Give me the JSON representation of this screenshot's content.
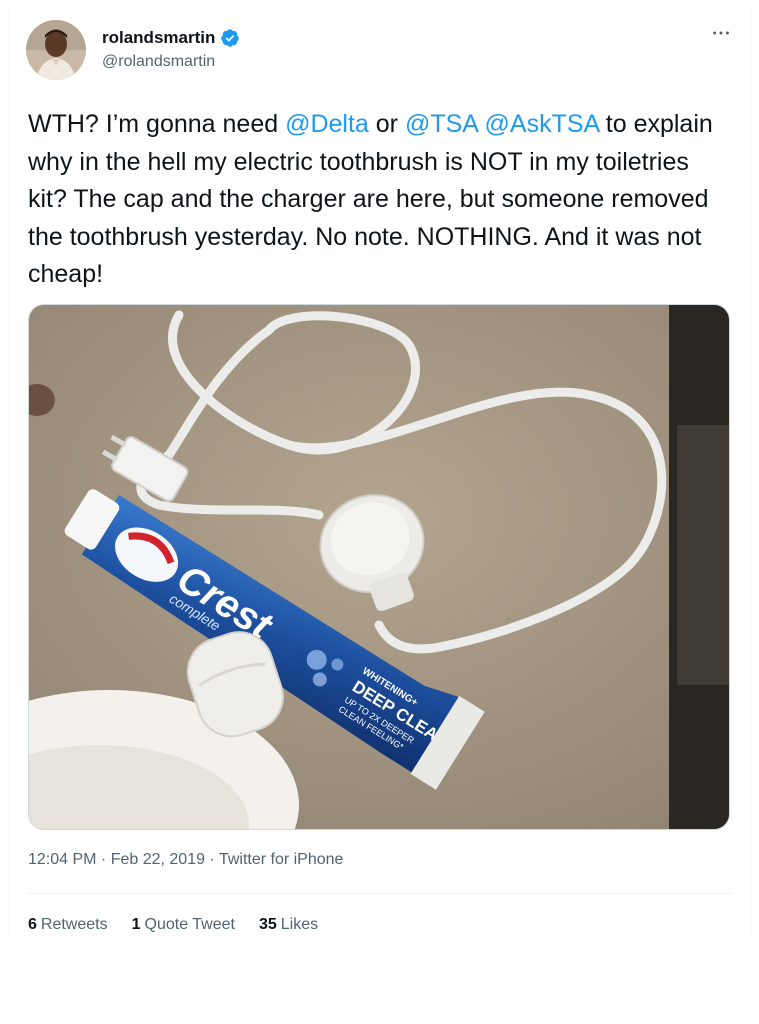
{
  "author": {
    "display_name": "rolandsmartin",
    "handle": "@rolandsmartin",
    "verified": true
  },
  "menu_icon": "more-horizontal-icon",
  "tweet": {
    "segments": [
      {
        "text": "WTH? I’m gonna need ",
        "type": "text"
      },
      {
        "text": "@Delta",
        "type": "mention"
      },
      {
        "text": " or ",
        "type": "text"
      },
      {
        "text": "@TSA",
        "type": "mention"
      },
      {
        "text": " ",
        "type": "text"
      },
      {
        "text": "@AskTSA",
        "type": "mention"
      },
      {
        "text": " to explain why in the hell my electric toothbrush is NOT in my toiletries kit? The cap and the charger are here, but someone removed the toothbrush yesterday. No note. NOTHING. And it was not cheap!",
        "type": "text"
      }
    ]
  },
  "media": {
    "tube_brand": "Crest",
    "tube_line": "complete",
    "tube_labels": [
      "WHITENING+",
      "DEEP CLEAN",
      "UP TO 2X DEEPER",
      "CLEAN FEELING*"
    ]
  },
  "meta": {
    "time": "12:04 PM",
    "date": "Feb 22, 2019",
    "source": "Twitter for iPhone",
    "separator": " · "
  },
  "stats": [
    {
      "count": "6",
      "label": "Retweets"
    },
    {
      "count": "1",
      "label": "Quote Tweet"
    },
    {
      "count": "35",
      "label": "Likes"
    }
  ],
  "colors": {
    "link": "#1d9bf0",
    "text": "#0f1419",
    "secondary": "#536471",
    "verified": "#1d9bf0"
  }
}
